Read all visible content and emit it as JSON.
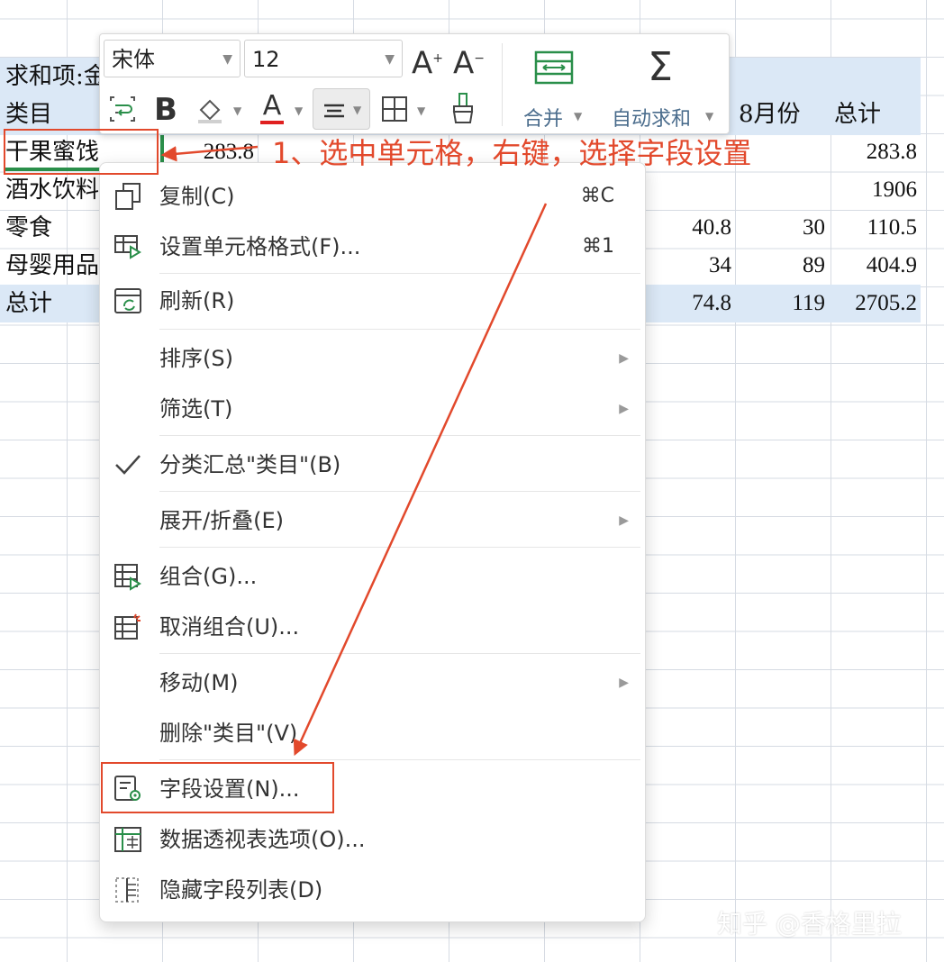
{
  "sheet": {
    "header_label": "求和项:金",
    "col_label": "类目",
    "col_aug": "8月份",
    "col_total": "总计",
    "rows": [
      {
        "name": "干果蜜饯",
        "first": "283.8",
        "total": "283.8"
      },
      {
        "name": "酒水饮料",
        "total": "1906"
      },
      {
        "name": "零食",
        "v1": "40.8",
        "v2": "30",
        "total": "110.5"
      },
      {
        "name": "母婴用品",
        "v1": "34",
        "v2": "89",
        "total": "404.9"
      }
    ],
    "grand_total": {
      "name": "总计",
      "v1": "74.8",
      "v2": "119",
      "total": "2705.2"
    }
  },
  "toolbar": {
    "font_name": "宋体",
    "font_size": "12",
    "merge_label": "合并",
    "autosum_label": "自动求和"
  },
  "menu": {
    "items": [
      {
        "label": "复制(C)",
        "shortcut": "⌘C",
        "icon": "copy-icon"
      },
      {
        "label": "设置单元格格式(F)...",
        "shortcut": "⌘1",
        "icon": "format-cells-icon"
      },
      {
        "label": "刷新(R)",
        "icon": "refresh-icon"
      },
      {
        "label": "排序(S)",
        "icon": "none"
      },
      {
        "label": "筛选(T)",
        "icon": "none"
      },
      {
        "label": "分类汇总\"类目\"(B)",
        "icon": "check-icon"
      },
      {
        "label": "展开/折叠(E)",
        "icon": "none"
      },
      {
        "label": "组合(G)...",
        "icon": "group-icon"
      },
      {
        "label": "取消组合(U)...",
        "icon": "ungroup-icon"
      },
      {
        "label": "移动(M)",
        "icon": "none"
      },
      {
        "label": "删除\"类目\"(V)",
        "icon": "none"
      },
      {
        "label": "字段设置(N)...",
        "icon": "field-settings-icon"
      },
      {
        "label": "数据透视表选项(O)...",
        "icon": "pivot-options-icon"
      },
      {
        "label": "隐藏字段列表(D)",
        "icon": "hide-field-list-icon"
      }
    ]
  },
  "annotation": "1、选中单元格，右键，选择字段设置",
  "watermark": "知乎 @香格里拉",
  "colors": {
    "accent_red": "#e2492c",
    "header_blue": "#dbe8f6",
    "select_green": "#2a8f4a"
  }
}
